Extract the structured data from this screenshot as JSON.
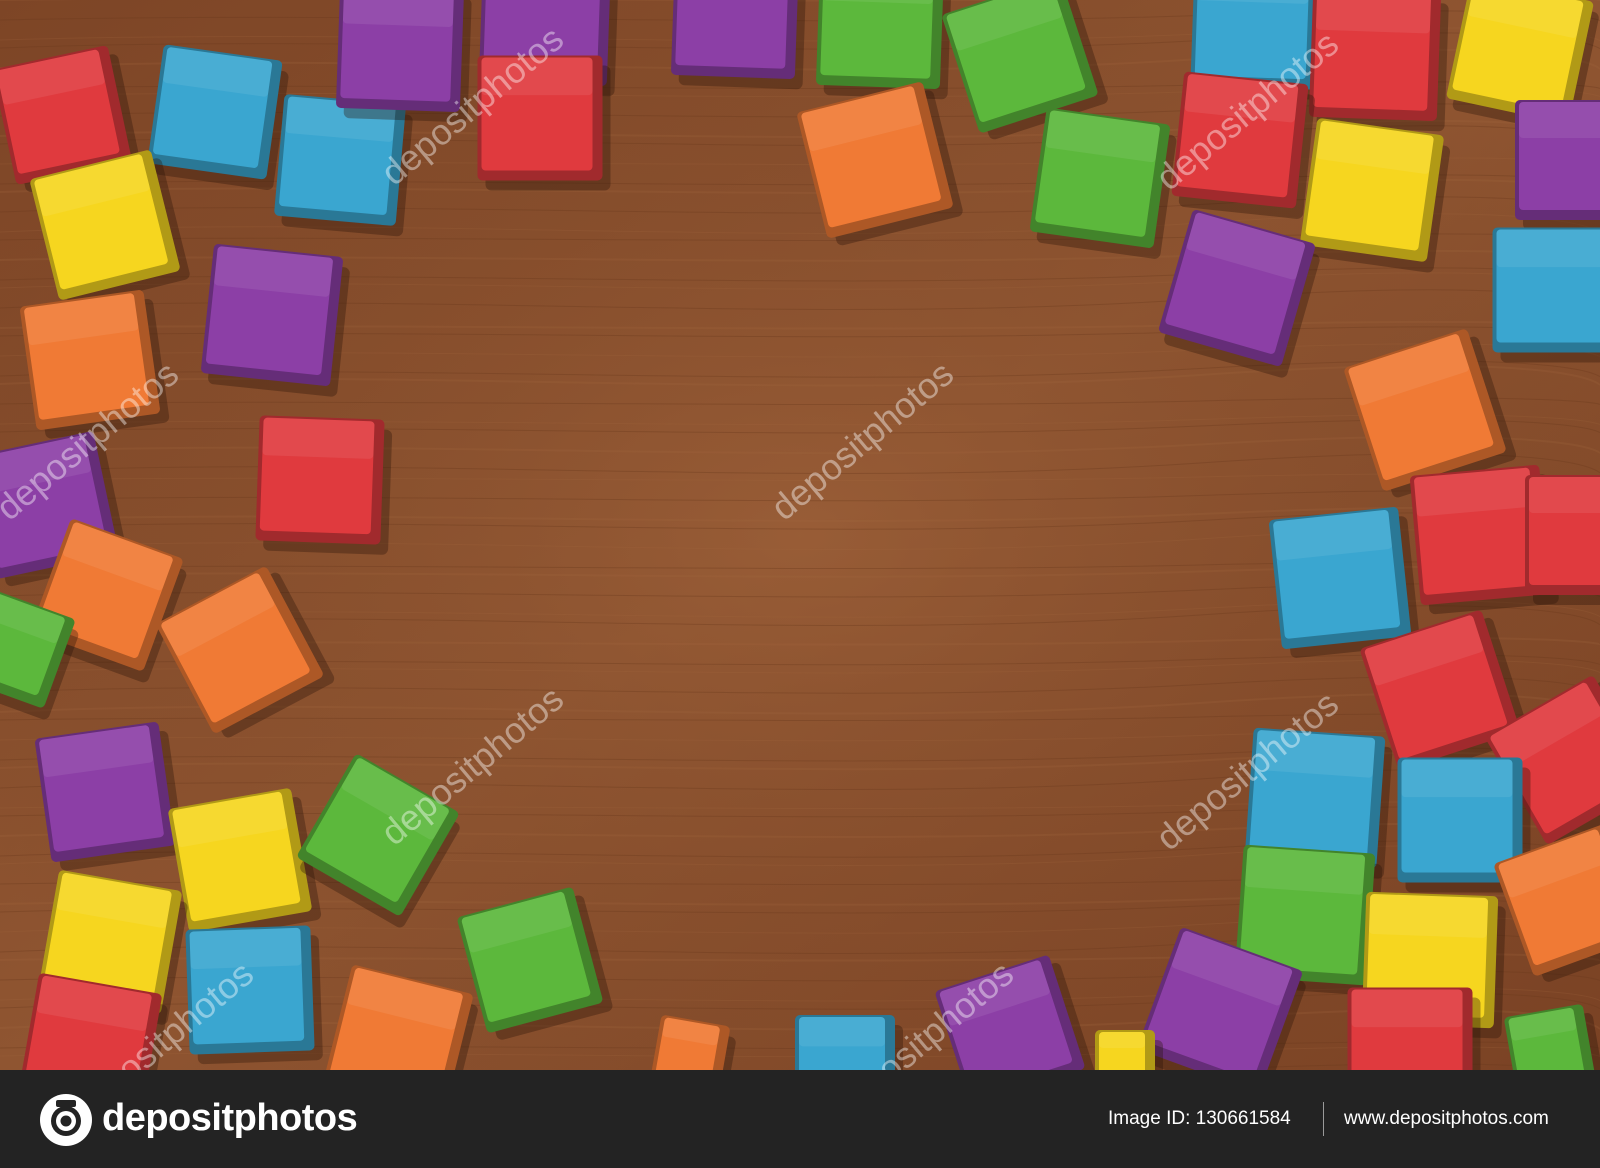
{
  "photo": {
    "subject": "colorful wooden cubes on wood table",
    "background_color": "#8a4f2c",
    "block_colors": {
      "red": "#e03a3e",
      "blue": "#3aa6d0",
      "yellow": "#f6d61f",
      "orange": "#f07a35",
      "green": "#5cb83c",
      "purple": "#8c3fa6"
    },
    "watermark": "depositphotos"
  },
  "footer": {
    "logo_text": "depositphotos",
    "image_id": "Image ID: 130661584",
    "site_url": "www.depositphotos.com",
    "background_color": "#232323"
  }
}
